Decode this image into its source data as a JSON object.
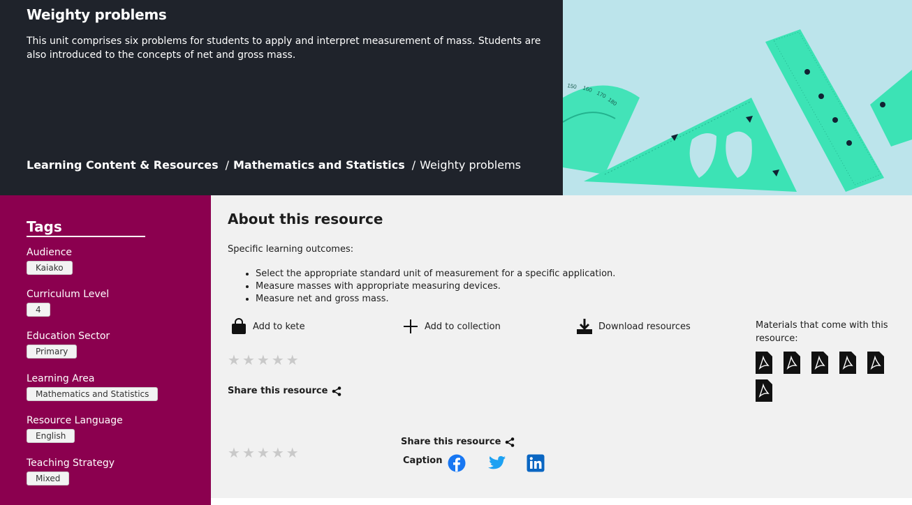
{
  "hero": {
    "title": "Weighty problems",
    "description": "This unit comprises six problems for students to apply and interpret measurement of mass. Students are also introduced to the concepts of net and gross mass.",
    "breadcrumb": [
      "Learning Content & Resources",
      "Mathematics and Statistics",
      "Weighty problems"
    ],
    "breadcrumb_separator": "/"
  },
  "tags": {
    "heading": "Tags",
    "groups": [
      {
        "label": "Audience",
        "value": "Kaiako"
      },
      {
        "label": "Curriculum Level",
        "value": "4"
      },
      {
        "label": "Education Sector",
        "value": "Primary"
      },
      {
        "label": "Learning Area",
        "value": "Mathematics and Statistics"
      },
      {
        "label": "Resource Language",
        "value": "English"
      },
      {
        "label": "Teaching Strategy",
        "value": "Mixed"
      }
    ]
  },
  "about": {
    "heading": "About this resource",
    "intro": "Specific learning outcomes:",
    "outcomes": [
      "Select the appropriate standard unit of measurement for a specific application.",
      "Measure masses with appropriate measuring devices.",
      "Measure net and gross mass."
    ],
    "actions": {
      "kete": "Add to kete",
      "collection": "Add to collection",
      "download": "Download resources"
    },
    "materials_label": "Materials that come with this resource:",
    "materials_icons": [
      "pdf-icon",
      "pdf-icon",
      "pdf-icon",
      "pdf-icon",
      "pdf-icon",
      "pdf-icon"
    ],
    "share_label": "Share this resource",
    "share_label_2": "Share this resource",
    "caption_label": "Caption",
    "rating_stars": 5,
    "social": [
      "facebook-icon",
      "twitter-icon",
      "linkedin-icon"
    ]
  },
  "colors": {
    "hero_bg": "#1f232b",
    "sidebar_bg": "#8b004f",
    "main_bg": "#f1f1f1",
    "ruler": "#3ce3b5",
    "image_bg": "#bce4eb",
    "facebook": "#1877f2",
    "twitter": "#1da1f2",
    "linkedin": "#0a66c2"
  }
}
